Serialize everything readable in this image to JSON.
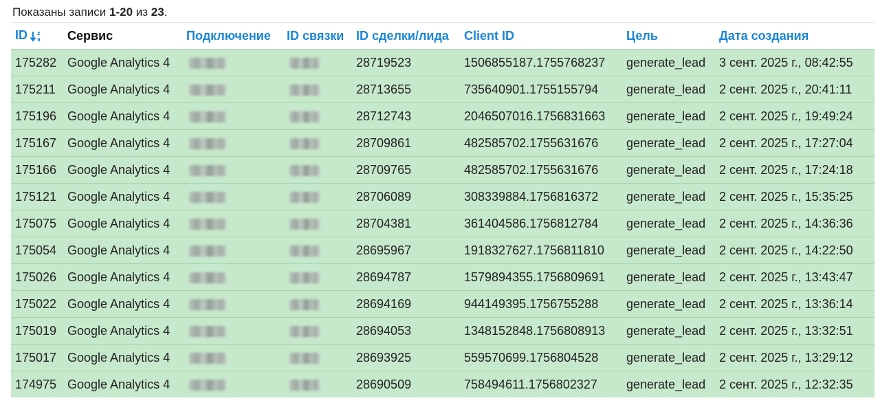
{
  "summary": {
    "prefix": "Показаны записи ",
    "range": "1-20",
    "middle": " из ",
    "total": "23",
    "suffix": "."
  },
  "columns": {
    "id": "ID",
    "service": "Сервис",
    "connection": "Подключение",
    "link_id": "ID связки",
    "deal_id": "ID сделки/лида",
    "client_id": "Client ID",
    "goal": "Цель",
    "created": "Дата создания"
  },
  "sort_icon": "sort-alpha-down-icon",
  "colors": {
    "link": "#1a86d9",
    "row_bg": "#c6e8cb",
    "row_border": "#a4d4ab"
  },
  "rows": [
    {
      "id": "175282",
      "service": "Google Analytics 4",
      "deal_id": "28719523",
      "client_id": "1506855187.1755768237",
      "goal": "generate_lead",
      "created": "3 сент. 2025 г., 08:42:55"
    },
    {
      "id": "175211",
      "service": "Google Analytics 4",
      "deal_id": "28713655",
      "client_id": "735640901.1755155794",
      "goal": "generate_lead",
      "created": "2 сент. 2025 г., 20:41:11"
    },
    {
      "id": "175196",
      "service": "Google Analytics 4",
      "deal_id": "28712743",
      "client_id": "2046507016.1756831663",
      "goal": "generate_lead",
      "created": "2 сент. 2025 г., 19:49:24"
    },
    {
      "id": "175167",
      "service": "Google Analytics 4",
      "deal_id": "28709861",
      "client_id": "482585702.1755631676",
      "goal": "generate_lead",
      "created": "2 сент. 2025 г., 17:27:04"
    },
    {
      "id": "175166",
      "service": "Google Analytics 4",
      "deal_id": "28709765",
      "client_id": "482585702.1755631676",
      "goal": "generate_lead",
      "created": "2 сент. 2025 г., 17:24:18"
    },
    {
      "id": "175121",
      "service": "Google Analytics 4",
      "deal_id": "28706089",
      "client_id": "308339884.1756816372",
      "goal": "generate_lead",
      "created": "2 сент. 2025 г., 15:35:25"
    },
    {
      "id": "175075",
      "service": "Google Analytics 4",
      "deal_id": "28704381",
      "client_id": "361404586.1756812784",
      "goal": "generate_lead",
      "created": "2 сент. 2025 г., 14:36:36"
    },
    {
      "id": "175054",
      "service": "Google Analytics 4",
      "deal_id": "28695967",
      "client_id": "1918327627.1756811810",
      "goal": "generate_lead",
      "created": "2 сент. 2025 г., 14:22:50"
    },
    {
      "id": "175026",
      "service": "Google Analytics 4",
      "deal_id": "28694787",
      "client_id": "1579894355.1756809691",
      "goal": "generate_lead",
      "created": "2 сент. 2025 г., 13:43:47"
    },
    {
      "id": "175022",
      "service": "Google Analytics 4",
      "deal_id": "28694169",
      "client_id": "944149395.1756755288",
      "goal": "generate_lead",
      "created": "2 сент. 2025 г., 13:36:14"
    },
    {
      "id": "175019",
      "service": "Google Analytics 4",
      "deal_id": "28694053",
      "client_id": "1348152848.1756808913",
      "goal": "generate_lead",
      "created": "2 сент. 2025 г., 13:32:51"
    },
    {
      "id": "175017",
      "service": "Google Analytics 4",
      "deal_id": "28693925",
      "client_id": "559570699.1756804528",
      "goal": "generate_lead",
      "created": "2 сент. 2025 г., 13:29:12"
    },
    {
      "id": "174975",
      "service": "Google Analytics 4",
      "deal_id": "28690509",
      "client_id": "758494611.1756802327",
      "goal": "generate_lead",
      "created": "2 сент. 2025 г., 12:32:35"
    }
  ]
}
